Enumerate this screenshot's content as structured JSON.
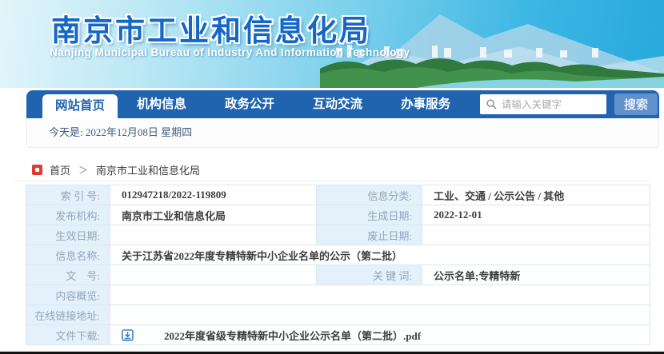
{
  "banner": {
    "title": "南京市工业和信息化局",
    "subtitle": "Nanjing Municipal Bureau of Industry And Information Technology"
  },
  "nav": {
    "tabs": [
      {
        "label": "网站首页",
        "active": true
      },
      {
        "label": "机构信息",
        "active": false
      },
      {
        "label": "政务公开",
        "active": false
      },
      {
        "label": "互动交流",
        "active": false
      },
      {
        "label": "办事服务",
        "active": false
      }
    ],
    "search": {
      "placeholder": "请输入关键字",
      "button_label": "搜索",
      "icon": "search-icon"
    }
  },
  "datebar": {
    "text": "今天是: 2022年12月08日  星期四"
  },
  "breadcrumb": {
    "home": "首页",
    "separator": "＞",
    "current": "南京市工业和信息化局"
  },
  "meta": {
    "index_no": {
      "label": "索 引 号:",
      "value": "012947218/2022-119809"
    },
    "category": {
      "label": "信息分类:",
      "value": "工业、交通 / 公示公告 / 其他"
    },
    "publisher": {
      "label": "发布机构:",
      "value": "南京市工业和信息化局"
    },
    "create_date": {
      "label": "生成日期:",
      "value": "2022-12-01"
    },
    "effective_date": {
      "label": "生效日期:",
      "value": ""
    },
    "expiry_date": {
      "label": "废止日期:",
      "value": ""
    },
    "title": {
      "label": "信息名称:",
      "value": "关于江苏省2022年度专精特新中小企业名单的公示（第二批）"
    },
    "doc_no": {
      "label": "文　号:",
      "value": ""
    },
    "keywords": {
      "label": "关 键 词:",
      "value": "公示名单;专精特新"
    },
    "summary": {
      "label": "内容概览:",
      "value": ""
    },
    "online_link": {
      "label": "在线链接地址:",
      "value": ""
    },
    "download": {
      "label": "文件下载:",
      "icon": "download-icon",
      "file_name": "2022年度省级专精特新中小企业公示名单（第二批）.pdf"
    }
  },
  "colors": {
    "nav_blue": "#2063ae",
    "search_button_blue": "#6191cb",
    "label_cell_bg": "#e4f1fa",
    "label_text": "#92a5ba",
    "breadcrumb_icon_red": "#e23a30",
    "download_icon_blue": "#3b82d0",
    "banner_title_blue": "#1467c7"
  }
}
